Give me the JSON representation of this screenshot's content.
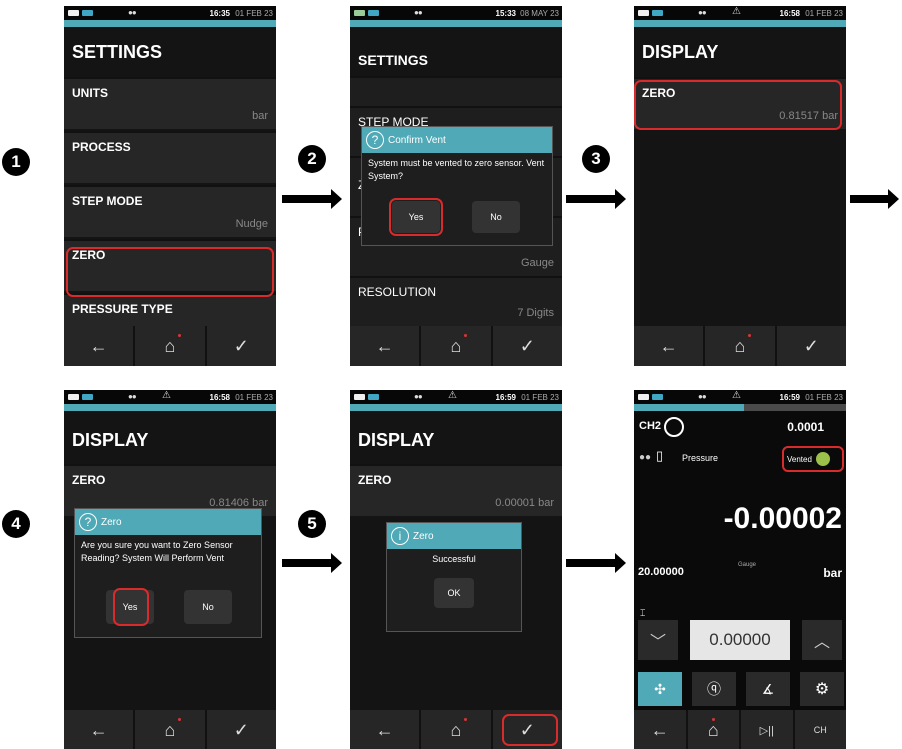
{
  "steps": [
    "1",
    "2",
    "3",
    "4",
    "5"
  ],
  "screens": {
    "s1": {
      "time": "16:35",
      "date": "01 FEB 23",
      "title": "SETTINGS",
      "rows": [
        {
          "label": "UNITS",
          "value": "bar"
        },
        {
          "label": "PROCESS",
          "value": ""
        },
        {
          "label": "STEP MODE",
          "value": "Nudge"
        },
        {
          "label": "ZERO",
          "value": ""
        },
        {
          "label": "PRESSURE TYPE",
          "value": ""
        }
      ]
    },
    "s2": {
      "time": "15:33",
      "date": "08 MAY 23",
      "title": "SETTINGS",
      "rows": [
        {
          "label": "STEP MODE",
          "value": ""
        },
        {
          "label": "Z",
          "value": ""
        },
        {
          "label": "P",
          "value": "Gauge"
        },
        {
          "label": "RESOLUTION",
          "value": "7 Digits"
        }
      ],
      "dialog": {
        "title": "Confirm Vent",
        "message": "System must be vented to zero sensor. Vent System?",
        "yes": "Yes",
        "no": "No"
      }
    },
    "s3": {
      "time": "16:58",
      "date": "01 FEB 23",
      "title": "DISPLAY",
      "rows": [
        {
          "label": "ZERO",
          "value": "0.81517 bar"
        }
      ]
    },
    "s4": {
      "time": "16:58",
      "date": "01 FEB 23",
      "title": "DISPLAY",
      "rows": [
        {
          "label": "ZERO",
          "value": "0.81406 bar"
        }
      ],
      "dialog": {
        "title": "Zero",
        "message": "Are you sure you want to Zero Sensor Reading? System Will Perform Vent",
        "yes": "Yes",
        "no": "No"
      }
    },
    "s5": {
      "time": "16:59",
      "date": "01 FEB 23",
      "title": "DISPLAY",
      "rows": [
        {
          "label": "ZERO",
          "value": "0.00001 bar"
        }
      ],
      "dialog": {
        "title": "Zero",
        "message": "Successful",
        "ok": "OK"
      }
    },
    "s6": {
      "time": "16:59",
      "date": "01 FEB 23",
      "channel": "CH2",
      "ch_value": "0.0001",
      "mode": "Pressure",
      "vented": "Vented",
      "reading": "-0.00002",
      "range": "20.00000",
      "type": "Gauge",
      "unit": "bar",
      "setpoint": "0.00000"
    }
  },
  "icons": {
    "back": "←",
    "home": "⌂",
    "check": "✓",
    "play_pause": "▷||",
    "settings": "⚙"
  },
  "colors": {
    "accent": "#4fa9b6",
    "highlight": "#d92b2b"
  }
}
